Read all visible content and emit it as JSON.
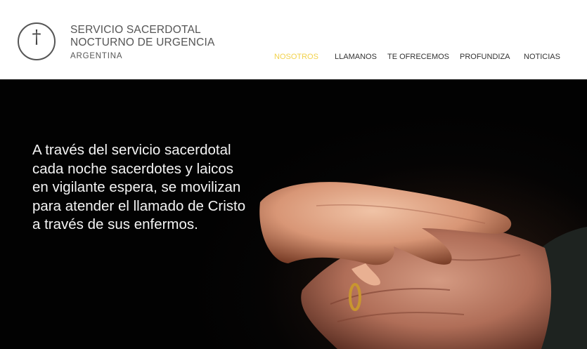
{
  "brand": {
    "line1": "SERVICIO SACERDOTAL",
    "line2": "NOCTURNO DE URGENCIA",
    "line3": "ARGENTINA",
    "icon": "cross-icon"
  },
  "nav": {
    "items": [
      {
        "label": "NOSOTROS",
        "active": true
      },
      {
        "label": "LLAMANOS",
        "active": false
      },
      {
        "label": "TE OFRECEMOS",
        "active": false
      },
      {
        "label": "PROFUNDIZA",
        "active": false
      },
      {
        "label": "NOTICIAS",
        "active": false
      }
    ]
  },
  "hero": {
    "text": "A través del servicio sacerdotal\ncada noche sacerdotes y laicos\nen vigilante espera, se movilizan\npara atender el llamado de Cristo\na través de sus enfermos.",
    "image": "hands-holding-image"
  },
  "colors": {
    "active_nav": "#f2d24b",
    "header_bg": "#ffffff",
    "hero_bg": "#050404",
    "text_dark": "#555555"
  }
}
